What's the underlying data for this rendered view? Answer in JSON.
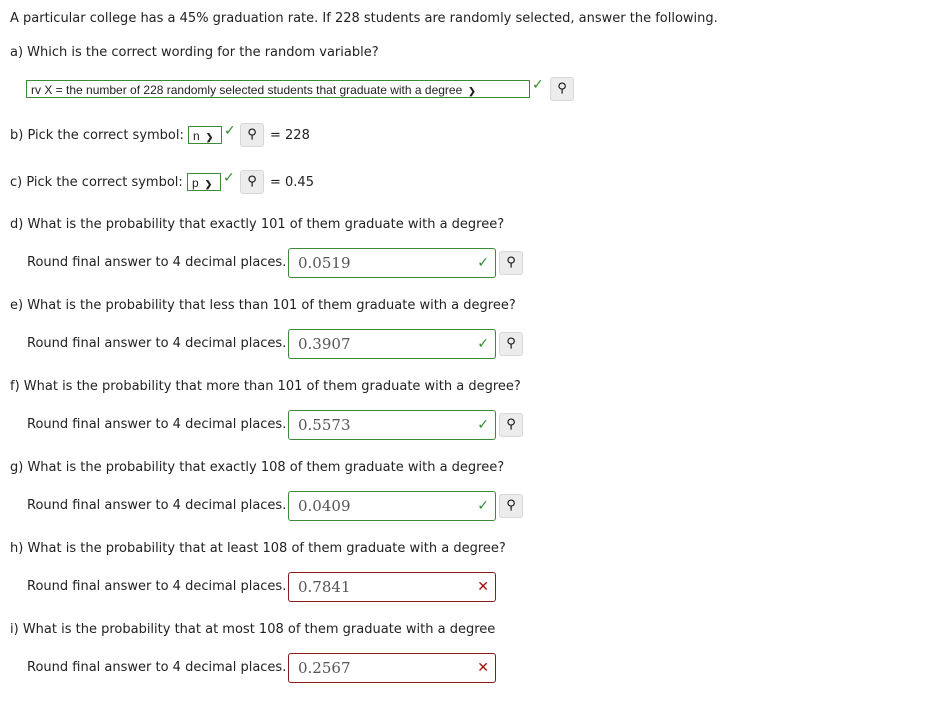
{
  "intro": "A particular college has a 45% graduation rate. If 228 students are randomly selected, answer the following.",
  "a": {
    "question": "a) Which is the correct wording for the random variable?",
    "selected": "rv X = the number of 228 randomly selected students that graduate with a degree",
    "status": "correct"
  },
  "b": {
    "label": "b) Pick the correct symbol:",
    "selected": "n",
    "value_text": "= 228",
    "status": "correct"
  },
  "c": {
    "label": "c) Pick the correct symbol:",
    "selected": "p",
    "value_text": "= 0.45",
    "status": "correct"
  },
  "round_label": "Round final answer to 4 decimal places.",
  "questions": [
    {
      "question": "d) What is the probability that exactly 101 of them graduate with a degree?",
      "answer": "0.0519",
      "status": "correct"
    },
    {
      "question": "e) What is the probability that less than 101 of them graduate with a degree?",
      "answer": "0.3907",
      "status": "correct"
    },
    {
      "question": "f) What is the probability that more than 101 of them graduate with a degree?",
      "answer": "0.5573",
      "status": "correct"
    },
    {
      "question": "g) What is the probability that exactly 108 of them graduate with a degree?",
      "answer": "0.0409",
      "status": "correct"
    },
    {
      "question": "h) What is the probability that at least 108 of them graduate with a degree?",
      "answer": "0.7841",
      "status": "incorrect"
    },
    {
      "question": "i) What is the probability that at most 108 of them graduate with a degree",
      "answer": "0.2567",
      "status": "incorrect"
    }
  ],
  "icons": {
    "check": "✓",
    "cross": "✕",
    "key": "⚷",
    "chevron": "⌄"
  },
  "colors": {
    "correct": "#2e8b2e",
    "incorrect": "#a01010"
  }
}
